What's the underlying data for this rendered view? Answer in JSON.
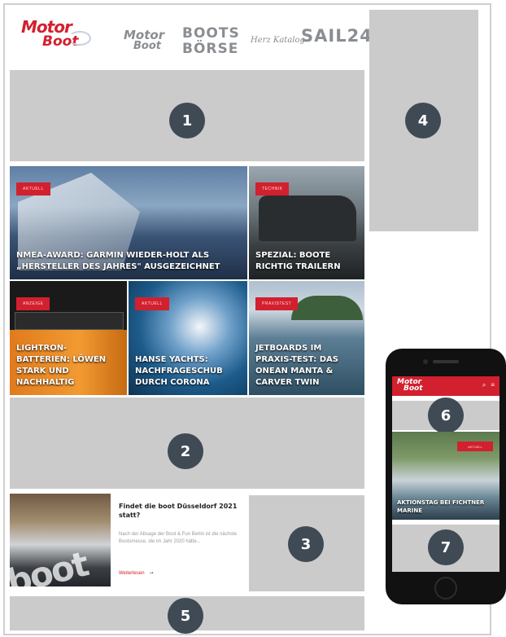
{
  "header": {
    "main_logo": {
      "line1": "Motor",
      "line2": "Boot"
    },
    "partner_logos": {
      "motorboot": {
        "line1": "Motor",
        "line2": "Boot"
      },
      "bootsboerse": {
        "line1": "BOOTS",
        "line2": "BÖRSE"
      },
      "herzkatalog": "Herz Katalog",
      "sail24": {
        "text": "SAIL",
        "num": "24"
      }
    }
  },
  "ad_slots": [
    "1",
    "2",
    "3",
    "4",
    "5",
    "6",
    "7"
  ],
  "tiles": [
    {
      "tag": "AKTUELL",
      "headline": "NMEA-AWARD: GARMIN WIEDER-HOLT ALS „HERSTELLER DES JAHRES\" AUSGEZEICHNET"
    },
    {
      "tag": "TECHNIK",
      "headline": "SPEZIAL: BOOTE RICHTIG TRAILERN"
    },
    {
      "tag": "ANZEIGE",
      "headline": "LIGHTRON-BATTERIEN: LÖWEN STARK UND NACHHALTIG"
    },
    {
      "tag": "AKTUELL",
      "headline": "HANSE YACHTS: NACHFRAGESCHUB DURCH CORONA"
    },
    {
      "tag": "PRAXISTEST",
      "headline": "JETBOARDS IM PRAXIS-TEST: DAS ONEAN MANTA & CARVER TWIN"
    }
  ],
  "teaser": {
    "title": "Findet die boot Düsseldorf 2021 statt?",
    "text": "Nach der Absage der Boot & Fun Berlin ist die nächste Bootsmesse, die im Jahr 2020 hätte...",
    "link": "Weiterlesen",
    "image_word": "boot"
  },
  "phone": {
    "logo": {
      "line1": "Motor",
      "line2": "Boot"
    },
    "tag": "AKTUELL",
    "headline": "AKTIONSTAG BEI FICHTNER MARINE"
  }
}
